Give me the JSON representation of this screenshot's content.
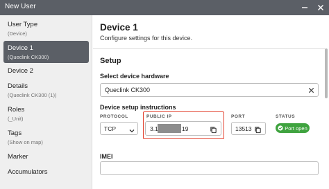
{
  "window": {
    "title": "New User"
  },
  "sidebar": {
    "items": [
      {
        "label": "User Type",
        "sub": "(Device)",
        "active": false
      },
      {
        "label": "Device 1",
        "sub": "(Queclink CK300)",
        "active": true
      },
      {
        "label": "Device 2",
        "sub": "",
        "active": false
      },
      {
        "label": "Details",
        "sub": "(Queclink CK300 (1))",
        "active": false
      },
      {
        "label": "Roles",
        "sub": "(_Unit)",
        "active": false
      },
      {
        "label": "Tags",
        "sub": "(Show on map)",
        "active": false
      },
      {
        "label": "Marker",
        "sub": "",
        "active": false
      },
      {
        "label": "Accumulators",
        "sub": "",
        "active": false
      }
    ]
  },
  "main": {
    "title": "Device 1",
    "subtitle": "Configure settings for this device.",
    "setup": {
      "section_title": "Setup",
      "hardware_label": "Select device hardware",
      "hardware_value": "Queclink CK300",
      "instructions_label": "Device setup instructions",
      "columns": {
        "protocol": "PROTOCOL",
        "public_ip": "PUBLIC IP",
        "port": "PORT",
        "status": "STATUS"
      },
      "protocol_value": "TCP",
      "ip_prefix": "3.1",
      "ip_suffix": "19",
      "port_value": "13513",
      "status_value": "Port open"
    },
    "imei_label": "IMEI",
    "imei_value": ""
  },
  "colors": {
    "titlebar": "#5b5f66",
    "active_item": "#5b5f66",
    "highlight_border": "#e2412e",
    "status_green": "#3fa33f"
  },
  "icons": {
    "minimize": "minimize-icon",
    "close": "close-icon",
    "clear": "clear-icon",
    "chevron": "chevron-down-icon",
    "copy": "copy-icon",
    "check": "check-icon"
  }
}
